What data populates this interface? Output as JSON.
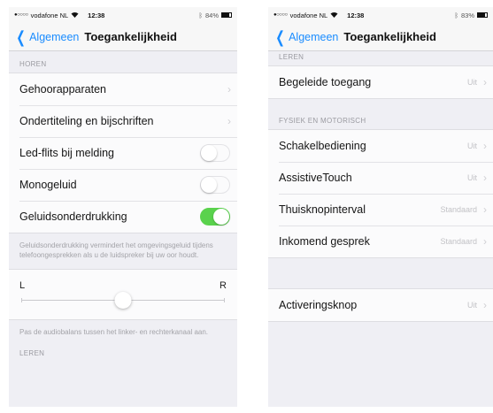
{
  "left": {
    "status": {
      "carrier": "vodafone NL",
      "time": "12:38",
      "battery": "84%",
      "battery_level": 0.84
    },
    "nav": {
      "back_label": "Algemeen",
      "title": "Toegankelijkheid"
    },
    "hearing_header": "HOREN",
    "hearing_rows": [
      {
        "label": "Gehoorapparaten"
      },
      {
        "label": "Ondertiteling en bijschriften"
      }
    ],
    "toggle_rows": [
      {
        "label": "Led-flits bij melding",
        "on": false
      },
      {
        "label": "Monogeluid",
        "on": false
      },
      {
        "label": "Geluidsonderdrukking",
        "on": true
      }
    ],
    "noise_note": "Geluidsonderdrukking vermindert het omgevingsgeluid tijdens telefoongesprekken als u de luidspreker bij uw oor houdt.",
    "balance": {
      "left_label": "L",
      "right_label": "R",
      "level": 0.5
    },
    "balance_note": "Pas de audiobalans tussen het linker- en rechterkanaal aan.",
    "learning_header": "LEREN"
  },
  "right": {
    "status": {
      "carrier": "vodafone NL",
      "time": "12:38",
      "battery": "83%",
      "battery_level": 0.83
    },
    "nav": {
      "back_label": "Algemeen",
      "title": "Toegankelijkheid"
    },
    "learning_header": "LEREN",
    "learning_rows": [
      {
        "label": "Begeleide toegang",
        "value": "Uit"
      }
    ],
    "physical_header": "FYSIEK EN MOTORISCH",
    "physical_rows": [
      {
        "label": "Schakelbediening",
        "value": "Uit"
      },
      {
        "label": "AssistiveTouch",
        "value": "Uit"
      },
      {
        "label": "Thuisknopinterval",
        "value": "Standaard"
      },
      {
        "label": "Inkomend gesprek",
        "value": "Standaard"
      }
    ],
    "activation_rows": [
      {
        "label": "Activeringsknop",
        "value": "Uit"
      }
    ]
  },
  "colors": {
    "accent": "#1a8cff",
    "toggle_on": "#5ad24d",
    "background": "#efeff4"
  },
  "icons": {
    "back": "chevron-left-icon",
    "disclosure": "chevron-right-icon",
    "wifi": "wifi-icon",
    "battery": "battery-icon"
  }
}
